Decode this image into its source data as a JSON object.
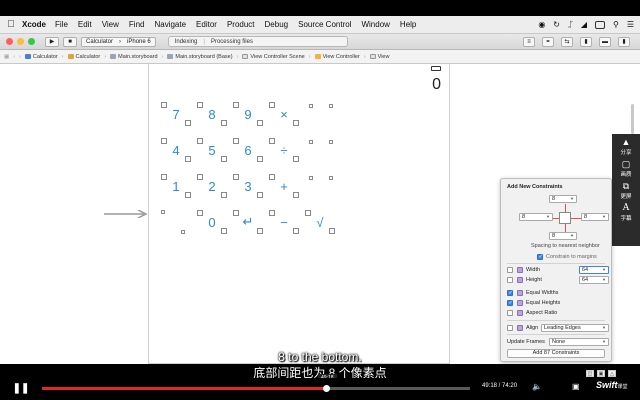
{
  "menubar": {
    "app": "Xcode",
    "items": [
      "File",
      "Edit",
      "View",
      "Find",
      "Navigate",
      "Editor",
      "Product",
      "Debug",
      "Source Control",
      "Window",
      "Help"
    ]
  },
  "toolbar": {
    "scheme_target": "Calculator",
    "scheme_device": "iPhone 6",
    "activity": "Indexing",
    "activity_detail": "Processing files"
  },
  "jumpbar": {
    "crumbs": [
      "Calculator",
      "Calculator",
      "Main.storyboard",
      "Main.storyboard (Base)",
      "View Controller Scene",
      "View Controller",
      "View"
    ]
  },
  "calculator": {
    "display": "0",
    "keys": [
      [
        "7",
        "8",
        "9",
        "×"
      ],
      [
        "4",
        "5",
        "6",
        "÷"
      ],
      [
        "1",
        "2",
        "3",
        "+"
      ],
      [
        "0",
        "↵",
        "−",
        "√"
      ]
    ]
  },
  "share_rail": {
    "items": [
      {
        "icon": "share-icon",
        "label": "分享"
      },
      {
        "icon": "screen-icon",
        "label": "画质"
      },
      {
        "icon": "window-icon",
        "label": "更屏"
      },
      {
        "icon": "subtitle-icon",
        "label": "字幕"
      }
    ]
  },
  "constraints": {
    "title": "Add New Constraints",
    "top": "8",
    "left": "8",
    "right": "8",
    "bottom": "8",
    "spacing_label": "Spacing to nearest neighbor",
    "constrain_margins_label": "Constrain to margins",
    "constrain_margins": true,
    "width_label": "Width",
    "width_value": "64",
    "width_checked": false,
    "height_label": "Height",
    "height_value": "64",
    "height_checked": false,
    "equal_widths_label": "Equal Widths",
    "equal_widths": true,
    "equal_heights_label": "Equal Heights",
    "equal_heights": true,
    "aspect_ratio_label": "Aspect Ratio",
    "aspect_ratio": false,
    "align_label": "Align",
    "align_value": "Leading Edges",
    "update_frames_label": "Update Frames",
    "update_frames_value": "None",
    "add_button": "Add 87 Constraints"
  },
  "subtitles": {
    "en": "8 to the bottom.",
    "zh": "底部间距也为 8 个像素点"
  },
  "player": {
    "time": "49:18 / 74:20",
    "tooltip": "49:18",
    "progress": 0.663,
    "logo": "Swift",
    "logo_sub": "课堂"
  },
  "colors": {
    "accent_key": "#2a8bd0",
    "progress": "#e02a2a",
    "checkbox_on": "#3f83e8",
    "strut": "#d9534f"
  }
}
